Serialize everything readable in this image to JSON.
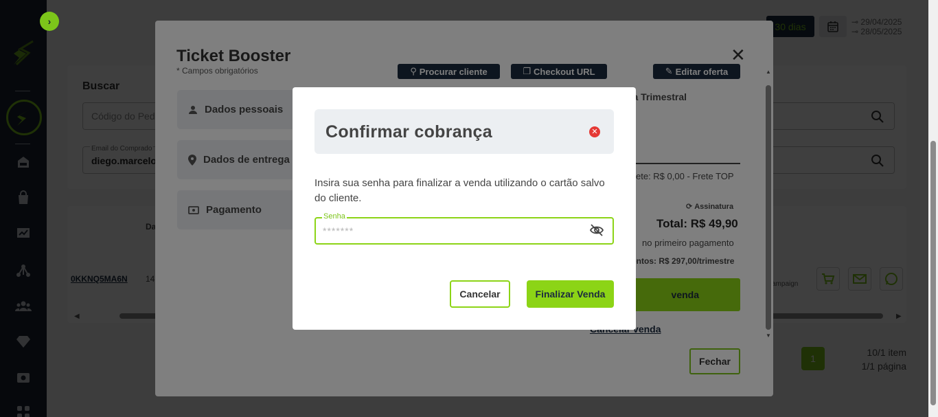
{
  "background": {
    "period_pill": "30 dias",
    "date_from": "29/04/2025",
    "date_to": "28/05/2025",
    "search_title": "Buscar",
    "order_code_placeholder": "Código do Ped",
    "buyer_email_label": "Email do Comprado",
    "buyer_email_value": "diego.marcelo",
    "col_header": "Da",
    "order_code": "0KKNQ5MA6N",
    "order_date_fragment": "14",
    "campaign_fragment": "ampaign",
    "current_page": "1",
    "items_info": "10/1 item",
    "pages_info": "1/1 página"
  },
  "ticket_booster": {
    "title": "Ticket Booster",
    "required_note": "* Campos obrigatórios",
    "steps": [
      "Dados pessoais",
      "Dados de entrega",
      "Pagamento"
    ],
    "actions": {
      "search_client": "Procurar cliente",
      "checkout_url": "Checkout URL",
      "edit_offer": "Editar oferta"
    },
    "offer_fragment": "ra Trimestral",
    "shipping_fragment": "ete: R$ 0,00 - Frete TOP",
    "subscription_label": "Assinatura",
    "total": "Total: R$ 49,90",
    "first_payment": "no primeiro pagamento",
    "recurring": "entos: R$ 297,00/trimestre",
    "finalize_fragment": "venda",
    "cancel_sale": "Cancelar venda",
    "close_button": "Fechar"
  },
  "confirm_dialog": {
    "title": "Confirmar cobrança",
    "message": "Insira sua senha para finalizar a venda utilizando o cartão salvo do cliente.",
    "password_label": "Senha",
    "password_placeholder": "*******",
    "cancel_button": "Cancelar",
    "finalize_button": "Finalizar Venda"
  },
  "colors": {
    "accent": "#8cd416",
    "dark": "#1b2a3f",
    "sidebar": "#1b2330",
    "danger": "#e53935"
  }
}
